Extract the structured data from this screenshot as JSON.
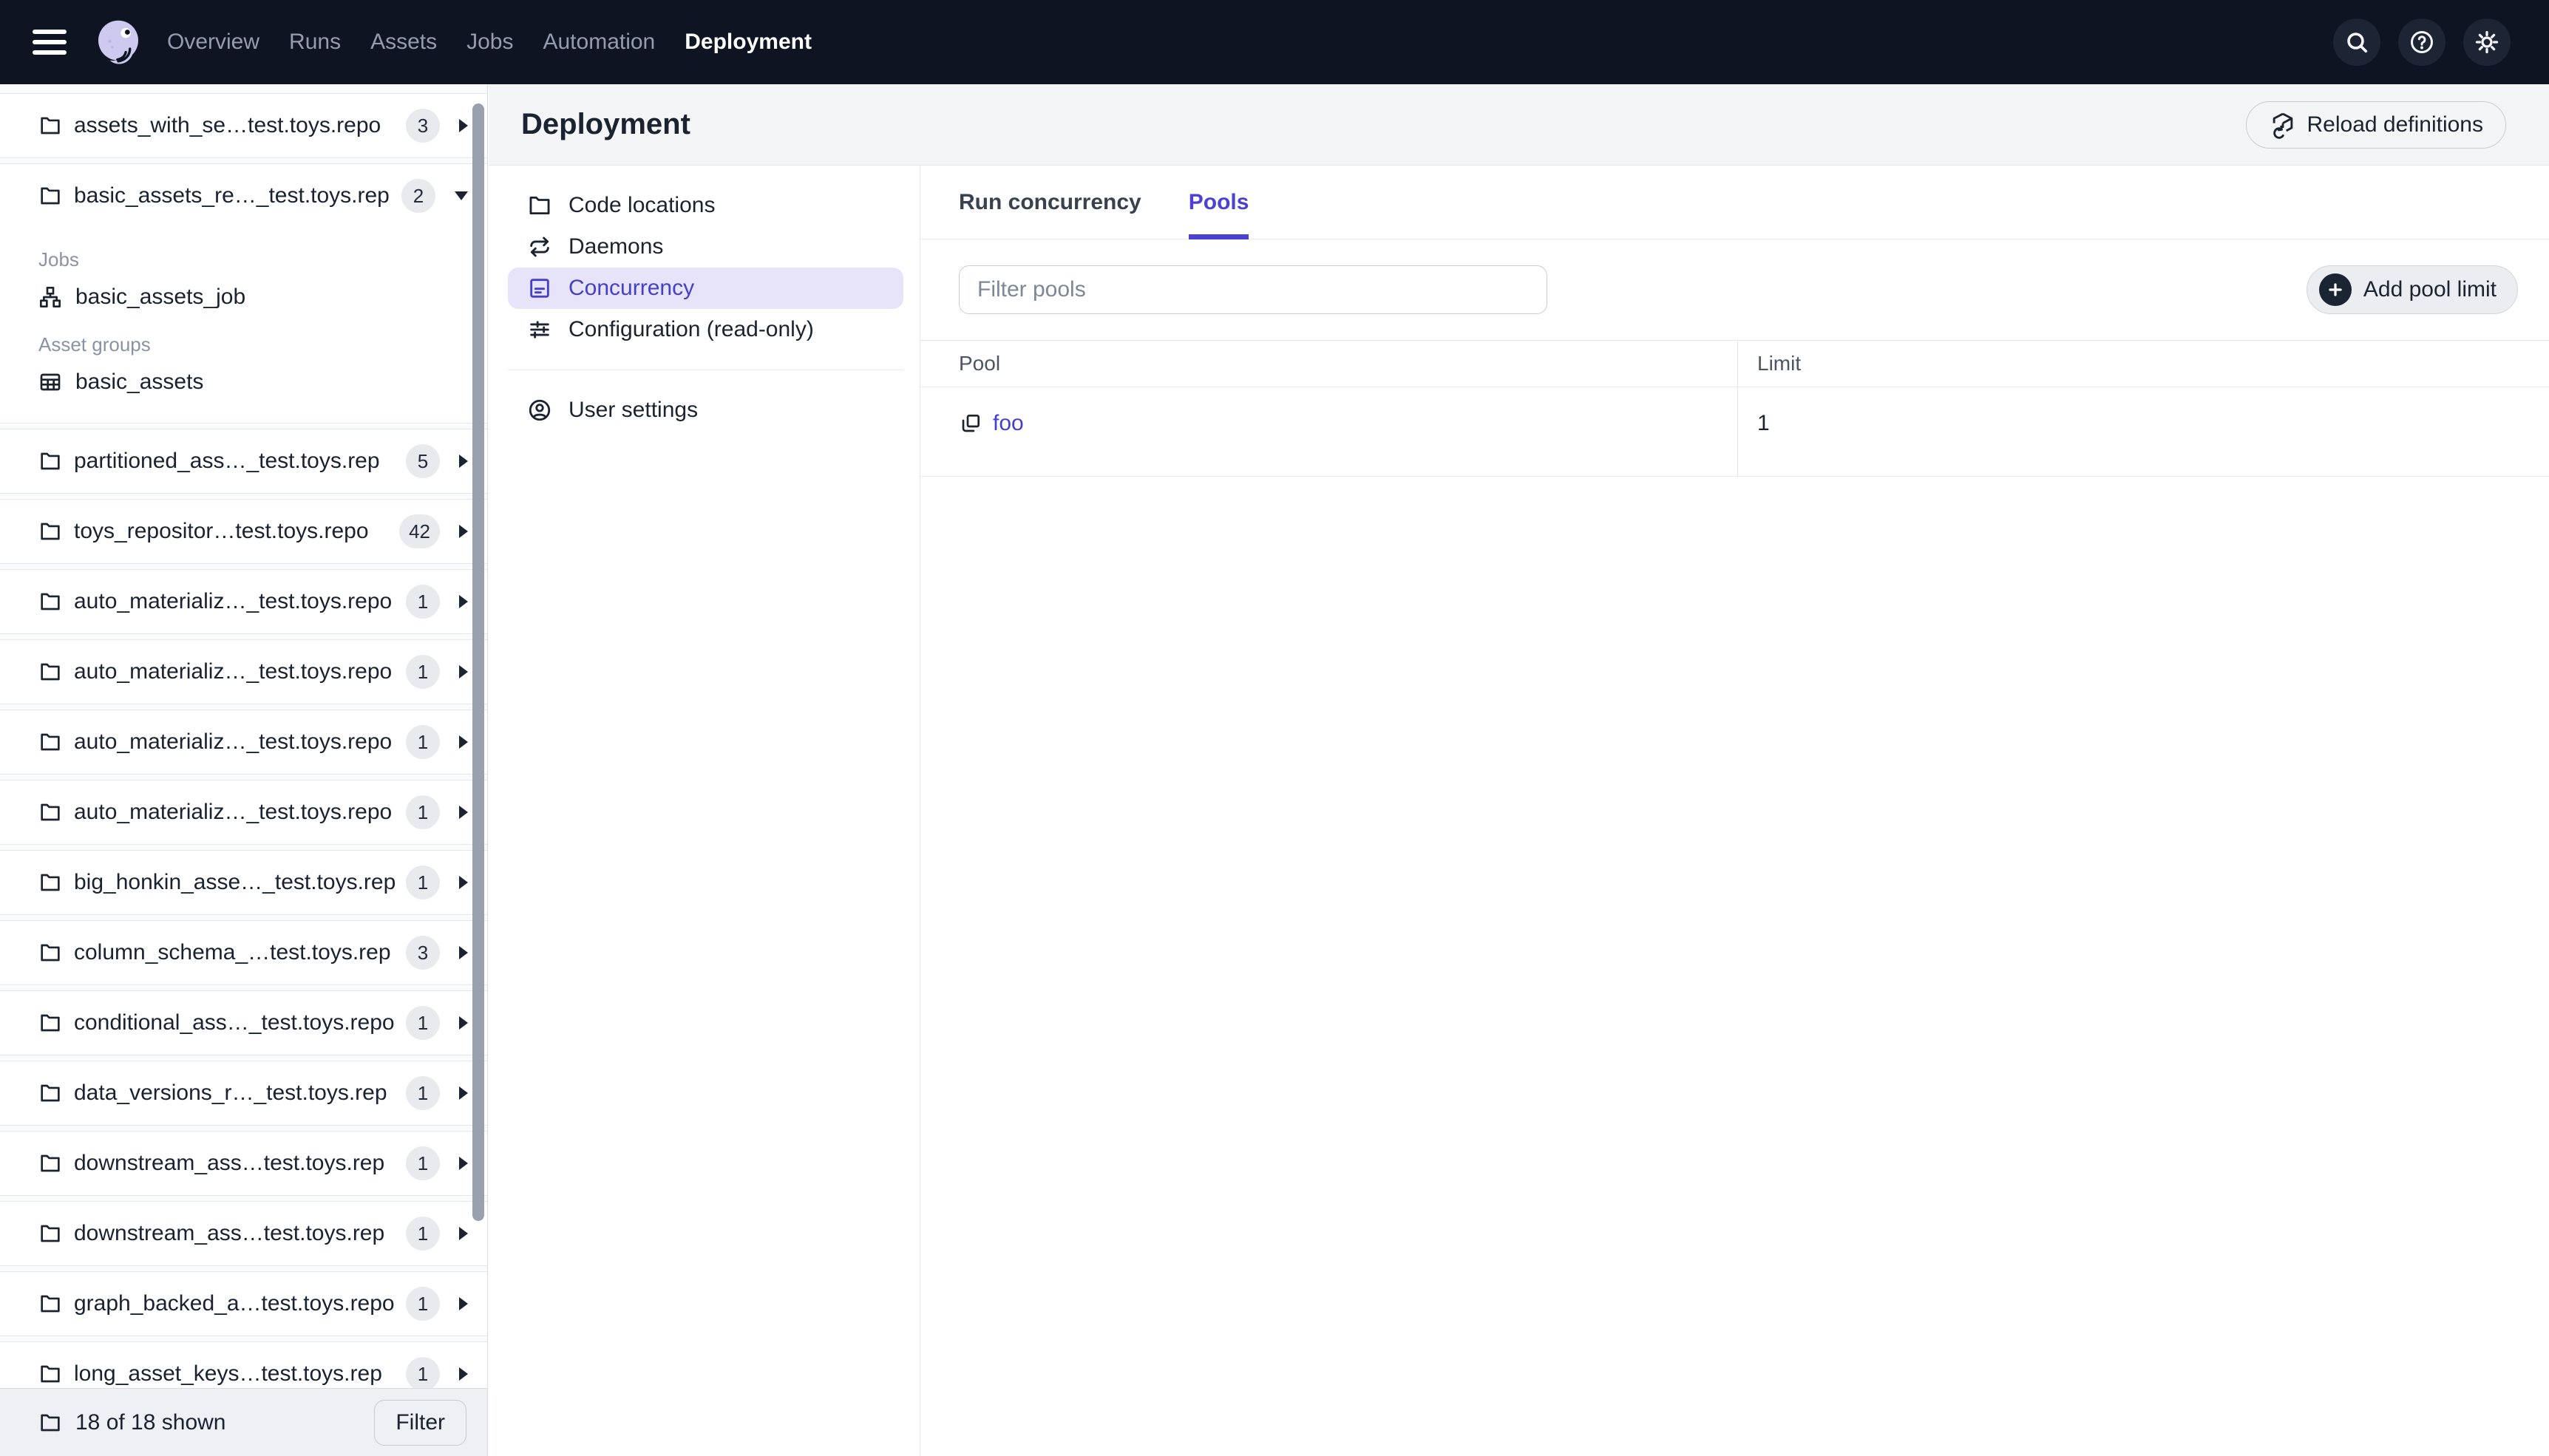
{
  "topnav": {
    "items": [
      {
        "label": "Overview"
      },
      {
        "label": "Runs"
      },
      {
        "label": "Assets"
      },
      {
        "label": "Jobs"
      },
      {
        "label": "Automation"
      },
      {
        "label": "Deployment",
        "active": true
      }
    ],
    "icons": [
      "search-icon",
      "help-icon",
      "settings-icon"
    ]
  },
  "sidebar": {
    "locations": [
      {
        "label": "assets_with_se…test.toys.repo",
        "count": "3"
      },
      {
        "label": "basic_assets_re…_test.toys.rep",
        "count": "2",
        "expanded": true
      },
      {
        "label": "partitioned_ass…_test.toys.rep",
        "count": "5"
      },
      {
        "label": "toys_repositor…test.toys.repo",
        "count": "42"
      },
      {
        "label": "auto_materializ…_test.toys.repo",
        "count": "1"
      },
      {
        "label": "auto_materializ…_test.toys.repo",
        "count": "1"
      },
      {
        "label": "auto_materializ…_test.toys.repo",
        "count": "1"
      },
      {
        "label": "auto_materializ…_test.toys.repo",
        "count": "1"
      },
      {
        "label": "big_honkin_asse…_test.toys.rep",
        "count": "1"
      },
      {
        "label": "column_schema_…test.toys.rep",
        "count": "3"
      },
      {
        "label": "conditional_ass…_test.toys.repo",
        "count": "1"
      },
      {
        "label": "data_versions_r…_test.toys.rep",
        "count": "1"
      },
      {
        "label": "downstream_ass…test.toys.rep",
        "count": "1"
      },
      {
        "label": "downstream_ass…test.toys.rep",
        "count": "1"
      },
      {
        "label": "graph_backed_a…test.toys.repo",
        "count": "1"
      },
      {
        "label": "long_asset_keys…test.toys.rep",
        "count": "1"
      }
    ],
    "expanded_sections": {
      "jobs_title": "Jobs",
      "jobs": [
        {
          "label": "basic_assets_job",
          "icon": "job-icon"
        }
      ],
      "asset_groups_title": "Asset groups",
      "asset_groups": [
        {
          "label": "basic_assets",
          "icon": "asset-group-icon"
        }
      ]
    },
    "footer": {
      "shown": "18 of 18 shown",
      "filter": "Filter"
    }
  },
  "header": {
    "title": "Deployment",
    "reload": "Reload definitions"
  },
  "deployment_nav": {
    "items": [
      {
        "label": "Code locations",
        "icon": "folder-icon"
      },
      {
        "label": "Daemons",
        "icon": "daemons-icon"
      },
      {
        "label": "Concurrency",
        "icon": "concurrency-icon",
        "active": true
      },
      {
        "label": "Configuration (read-only)",
        "icon": "configuration-icon"
      }
    ],
    "user_settings": "User settings"
  },
  "tabs": {
    "run_concurrency": "Run concurrency",
    "pools": "Pools",
    "active": "Pools"
  },
  "pools": {
    "filter_placeholder": "Filter pools",
    "add_button": "Add pool limit",
    "columns": {
      "pool": "Pool",
      "limit": "Limit"
    },
    "rows": [
      {
        "pool": "foo",
        "limit": "1"
      }
    ]
  },
  "colors": {
    "topnav_bg": "#0E1421",
    "accent": "#4B41D2",
    "accent_soft": "#E7E4F9",
    "link": "#443FCC",
    "header_bg": "#F4F5F7"
  }
}
